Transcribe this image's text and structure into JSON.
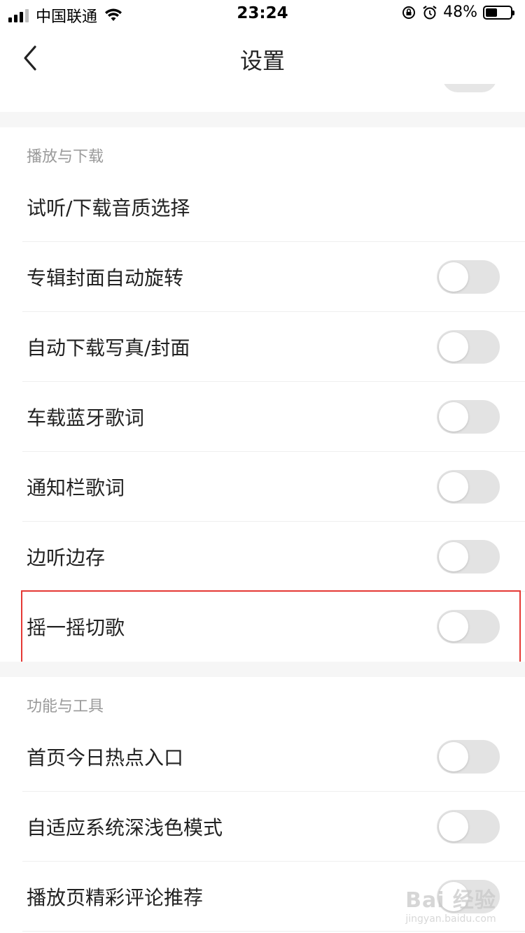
{
  "status_bar": {
    "carrier": "中国联通",
    "time": "23:24",
    "battery": "48%",
    "battery_level": 0.48,
    "icons": [
      "signal-icon",
      "wifi-icon",
      "rotation-lock-icon",
      "alarm-icon",
      "battery-icon"
    ]
  },
  "nav": {
    "title": "设置",
    "back_icon": "chevron-left-icon"
  },
  "sections": [
    {
      "title": "播放与下载",
      "items": [
        {
          "label": "试听/下载音质选择",
          "type": "link"
        },
        {
          "label": "专辑封面自动旋转",
          "type": "toggle",
          "on": false
        },
        {
          "label": "自动下载写真/封面",
          "type": "toggle",
          "on": false
        },
        {
          "label": "车载蓝牙歌词",
          "type": "toggle",
          "on": false
        },
        {
          "label": "通知栏歌词",
          "type": "toggle",
          "on": false
        },
        {
          "label": "边听边存",
          "type": "toggle",
          "on": false
        },
        {
          "label": "摇一摇切歌",
          "type": "toggle",
          "on": false,
          "highlighted": true
        }
      ]
    },
    {
      "title": "功能与工具",
      "items": [
        {
          "label": "首页今日热点入口",
          "type": "toggle",
          "on": false
        },
        {
          "label": "自适应系统深浅色模式",
          "type": "toggle",
          "on": false
        },
        {
          "label": "播放页精彩评论推荐",
          "type": "toggle",
          "on": false
        }
      ]
    }
  ],
  "colors": {
    "highlight": "#e53935",
    "toggle_off": "#e3e3e3",
    "section_title": "#9a9a9a"
  },
  "watermark": {
    "logo": "Bai 经验",
    "url": "jingyan.baidu.com"
  }
}
